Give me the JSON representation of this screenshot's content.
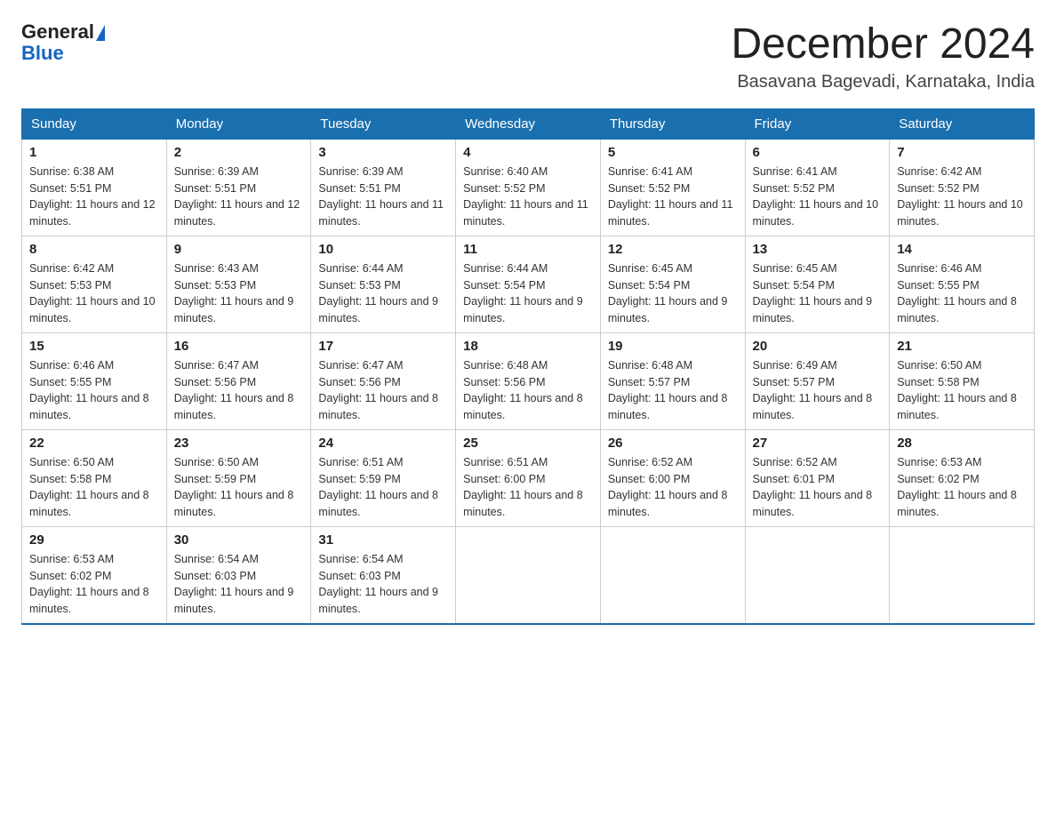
{
  "header": {
    "logo_general": "General",
    "logo_blue": "Blue",
    "title": "December 2024",
    "location": "Basavana Bagevadi, Karnataka, India"
  },
  "days_of_week": [
    "Sunday",
    "Monday",
    "Tuesday",
    "Wednesday",
    "Thursday",
    "Friday",
    "Saturday"
  ],
  "weeks": [
    [
      {
        "day": "1",
        "sunrise": "6:38 AM",
        "sunset": "5:51 PM",
        "daylight": "11 hours and 12 minutes."
      },
      {
        "day": "2",
        "sunrise": "6:39 AM",
        "sunset": "5:51 PM",
        "daylight": "11 hours and 12 minutes."
      },
      {
        "day": "3",
        "sunrise": "6:39 AM",
        "sunset": "5:51 PM",
        "daylight": "11 hours and 11 minutes."
      },
      {
        "day": "4",
        "sunrise": "6:40 AM",
        "sunset": "5:52 PM",
        "daylight": "11 hours and 11 minutes."
      },
      {
        "day": "5",
        "sunrise": "6:41 AM",
        "sunset": "5:52 PM",
        "daylight": "11 hours and 11 minutes."
      },
      {
        "day": "6",
        "sunrise": "6:41 AM",
        "sunset": "5:52 PM",
        "daylight": "11 hours and 10 minutes."
      },
      {
        "day": "7",
        "sunrise": "6:42 AM",
        "sunset": "5:52 PM",
        "daylight": "11 hours and 10 minutes."
      }
    ],
    [
      {
        "day": "8",
        "sunrise": "6:42 AM",
        "sunset": "5:53 PM",
        "daylight": "11 hours and 10 minutes."
      },
      {
        "day": "9",
        "sunrise": "6:43 AM",
        "sunset": "5:53 PM",
        "daylight": "11 hours and 9 minutes."
      },
      {
        "day": "10",
        "sunrise": "6:44 AM",
        "sunset": "5:53 PM",
        "daylight": "11 hours and 9 minutes."
      },
      {
        "day": "11",
        "sunrise": "6:44 AM",
        "sunset": "5:54 PM",
        "daylight": "11 hours and 9 minutes."
      },
      {
        "day": "12",
        "sunrise": "6:45 AM",
        "sunset": "5:54 PM",
        "daylight": "11 hours and 9 minutes."
      },
      {
        "day": "13",
        "sunrise": "6:45 AM",
        "sunset": "5:54 PM",
        "daylight": "11 hours and 9 minutes."
      },
      {
        "day": "14",
        "sunrise": "6:46 AM",
        "sunset": "5:55 PM",
        "daylight": "11 hours and 8 minutes."
      }
    ],
    [
      {
        "day": "15",
        "sunrise": "6:46 AM",
        "sunset": "5:55 PM",
        "daylight": "11 hours and 8 minutes."
      },
      {
        "day": "16",
        "sunrise": "6:47 AM",
        "sunset": "5:56 PM",
        "daylight": "11 hours and 8 minutes."
      },
      {
        "day": "17",
        "sunrise": "6:47 AM",
        "sunset": "5:56 PM",
        "daylight": "11 hours and 8 minutes."
      },
      {
        "day": "18",
        "sunrise": "6:48 AM",
        "sunset": "5:56 PM",
        "daylight": "11 hours and 8 minutes."
      },
      {
        "day": "19",
        "sunrise": "6:48 AM",
        "sunset": "5:57 PM",
        "daylight": "11 hours and 8 minutes."
      },
      {
        "day": "20",
        "sunrise": "6:49 AM",
        "sunset": "5:57 PM",
        "daylight": "11 hours and 8 minutes."
      },
      {
        "day": "21",
        "sunrise": "6:50 AM",
        "sunset": "5:58 PM",
        "daylight": "11 hours and 8 minutes."
      }
    ],
    [
      {
        "day": "22",
        "sunrise": "6:50 AM",
        "sunset": "5:58 PM",
        "daylight": "11 hours and 8 minutes."
      },
      {
        "day": "23",
        "sunrise": "6:50 AM",
        "sunset": "5:59 PM",
        "daylight": "11 hours and 8 minutes."
      },
      {
        "day": "24",
        "sunrise": "6:51 AM",
        "sunset": "5:59 PM",
        "daylight": "11 hours and 8 minutes."
      },
      {
        "day": "25",
        "sunrise": "6:51 AM",
        "sunset": "6:00 PM",
        "daylight": "11 hours and 8 minutes."
      },
      {
        "day": "26",
        "sunrise": "6:52 AM",
        "sunset": "6:00 PM",
        "daylight": "11 hours and 8 minutes."
      },
      {
        "day": "27",
        "sunrise": "6:52 AM",
        "sunset": "6:01 PM",
        "daylight": "11 hours and 8 minutes."
      },
      {
        "day": "28",
        "sunrise": "6:53 AM",
        "sunset": "6:02 PM",
        "daylight": "11 hours and 8 minutes."
      }
    ],
    [
      {
        "day": "29",
        "sunrise": "6:53 AM",
        "sunset": "6:02 PM",
        "daylight": "11 hours and 8 minutes."
      },
      {
        "day": "30",
        "sunrise": "6:54 AM",
        "sunset": "6:03 PM",
        "daylight": "11 hours and 9 minutes."
      },
      {
        "day": "31",
        "sunrise": "6:54 AM",
        "sunset": "6:03 PM",
        "daylight": "11 hours and 9 minutes."
      },
      null,
      null,
      null,
      null
    ]
  ],
  "labels": {
    "sunrise": "Sunrise:",
    "sunset": "Sunset:",
    "daylight": "Daylight:"
  }
}
